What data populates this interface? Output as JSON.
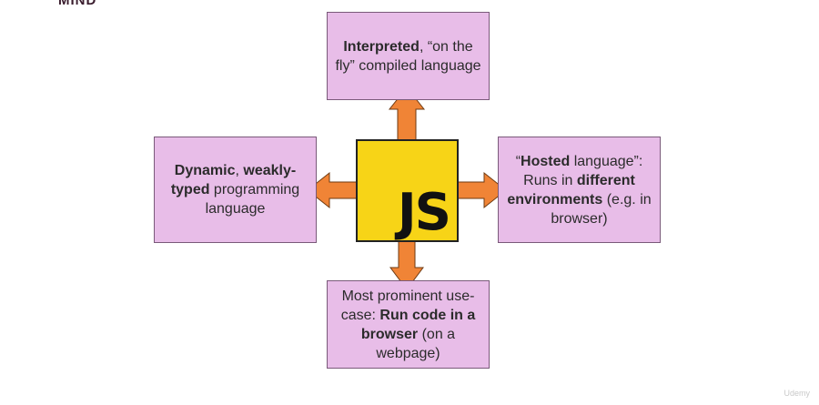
{
  "header": {
    "text": "MIND"
  },
  "colors": {
    "box_fill": "#e8bde8",
    "arrow_fill": "#f08436",
    "logo_fill": "#f7d417"
  },
  "logo": {
    "text": "JS"
  },
  "boxes": {
    "top": {
      "parts": [
        {
          "text": "Interpreted",
          "bold": true
        },
        {
          "text": ", “on the fly” compiled language",
          "bold": false
        }
      ]
    },
    "left": {
      "parts": [
        {
          "text": "Dynamic",
          "bold": true
        },
        {
          "text": ", ",
          "bold": false
        },
        {
          "text": "weakly-typed",
          "bold": true
        },
        {
          "text": " programming language",
          "bold": false
        }
      ]
    },
    "right": {
      "parts": [
        {
          "text": "“",
          "bold": false
        },
        {
          "text": "Hosted",
          "bold": true
        },
        {
          "text": " language”: Runs in ",
          "bold": false
        },
        {
          "text": "different environments",
          "bold": true
        },
        {
          "text": " (e.g. in browser)",
          "bold": false
        }
      ]
    },
    "bottom": {
      "parts": [
        {
          "text": "Most prominent use-case: ",
          "bold": false
        },
        {
          "text": "Run code in a browser",
          "bold": true
        },
        {
          "text": " (on a webpage)",
          "bold": false
        }
      ]
    }
  },
  "watermark": {
    "text": "Udemy"
  }
}
